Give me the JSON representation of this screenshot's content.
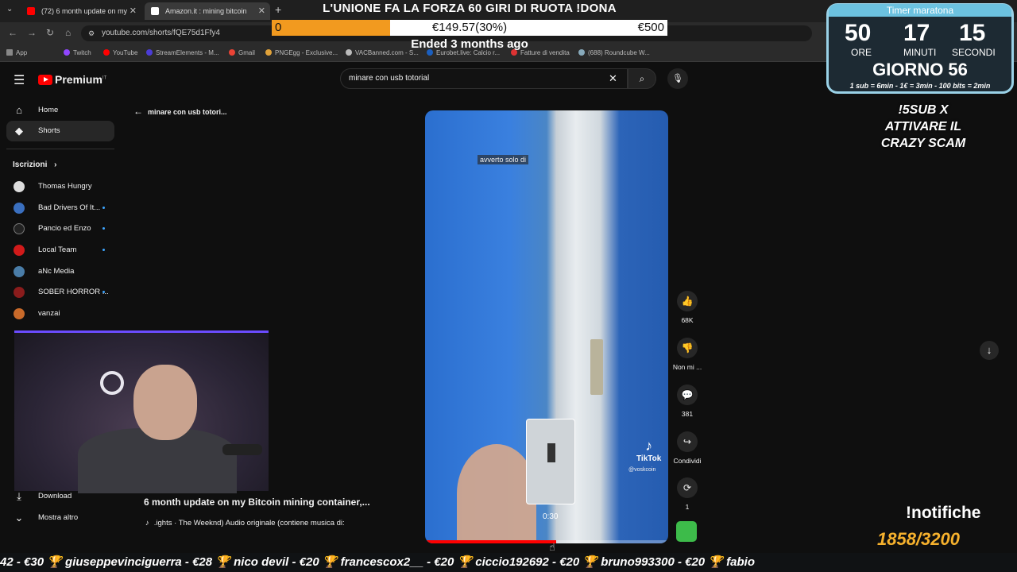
{
  "browser": {
    "tabs": [
      {
        "title": "(72) 6 month update on my",
        "active": false
      },
      {
        "title": "Amazon.it : mining bitcoin",
        "active": true
      }
    ],
    "new_tab": "+",
    "url": "youtube.com/shorts/fQE75d1Ffy4",
    "bookmarks": [
      "App",
      "Twitch",
      "YouTube",
      "StreamElements - M...",
      "Gmail",
      "PNGEgg - Exclusive...",
      "VACBanned.com - S...",
      "Eurobet.live: Calcio r...",
      "Fatture di vendita",
      "(688) Roundcube W..."
    ]
  },
  "donation_goal": {
    "title": "L'UNIONE FA LA FORZA 60 GIRI DI RUOTA !DONA",
    "start": "0",
    "current": "€149.57(30%)",
    "goal": "€500",
    "progress": 0.3,
    "ended": "Ended 3 months ago"
  },
  "timer": {
    "title": "Timer maratona",
    "hours": "50",
    "minutes": "17",
    "seconds": "15",
    "hours_label": "ORE",
    "minutes_label": "MINUTI",
    "seconds_label": "SECONDI",
    "day": "GIORNO 56",
    "rule": "1 sub = 6min - 1€ = 3min - 100 bits = 2min"
  },
  "promo": [
    "!5SUB X",
    "ATTIVARE IL",
    "CRAZY SCAM"
  ],
  "notifiche": {
    "label": "!notifiche",
    "count": "1858/3200"
  },
  "youtube": {
    "logo": "Premium",
    "logo_region": "IT",
    "search_value": "minare con usb totorial",
    "back_label": "minare con usb totori...",
    "nav": [
      {
        "label": "Home",
        "icon": "home-icon",
        "glyph": "⌂"
      },
      {
        "label": "Shorts",
        "icon": "shorts-icon",
        "glyph": "◆",
        "active": true
      }
    ],
    "subscriptions_label": "Iscrizioni",
    "subscriptions": [
      {
        "label": "Thomas Hungry",
        "color": "#dddddd",
        "dot": false
      },
      {
        "label": "Bad Drivers Of It...",
        "color": "#3a6fbf",
        "dot": true
      },
      {
        "label": "Pancio ed Enzo",
        "color": "#222222",
        "dot": true
      },
      {
        "label": "Local Team",
        "color": "#d11a1a",
        "dot": true
      },
      {
        "label": "aNc Media",
        "color": "#4a7da8",
        "dot": false
      },
      {
        "label": "SOBER HORROR ...",
        "color": "#8a1c1c",
        "dot": true
      },
      {
        "label": "vanzai",
        "color": "#c96a2a",
        "dot": false
      }
    ],
    "more": [
      {
        "label": "Download",
        "glyph": "⤓"
      },
      {
        "label": "Mostra altro",
        "glyph": "⌄"
      }
    ],
    "video": {
      "caption": "avverto solo di",
      "pip_time": "0:30",
      "tiktok": "TikTok",
      "tiktok_user": "@voskcoin",
      "progress": 0.54,
      "title": "6 month update on my Bitcoin mining container,...",
      "music": ".ights · The Weeknd)   Audio originale (contiene musica di:"
    },
    "actions": [
      {
        "name": "like",
        "glyph": "👍",
        "label": "68K"
      },
      {
        "name": "dislike",
        "glyph": "👎",
        "label": "Non mi ..."
      },
      {
        "name": "comments",
        "glyph": "💬",
        "label": "381"
      },
      {
        "name": "share",
        "glyph": "↪",
        "label": "Condividi"
      },
      {
        "name": "remix",
        "glyph": "⟳",
        "label": "1"
      }
    ]
  },
  "ticker": "42 - €30   🏆 giuseppevinciguerra - €28   🏆 nico devil - €20   🏆 francescox2__ - €20   🏆 ciccio192692 - €20   🏆 bruno993300 - €20   🏆 fabio"
}
